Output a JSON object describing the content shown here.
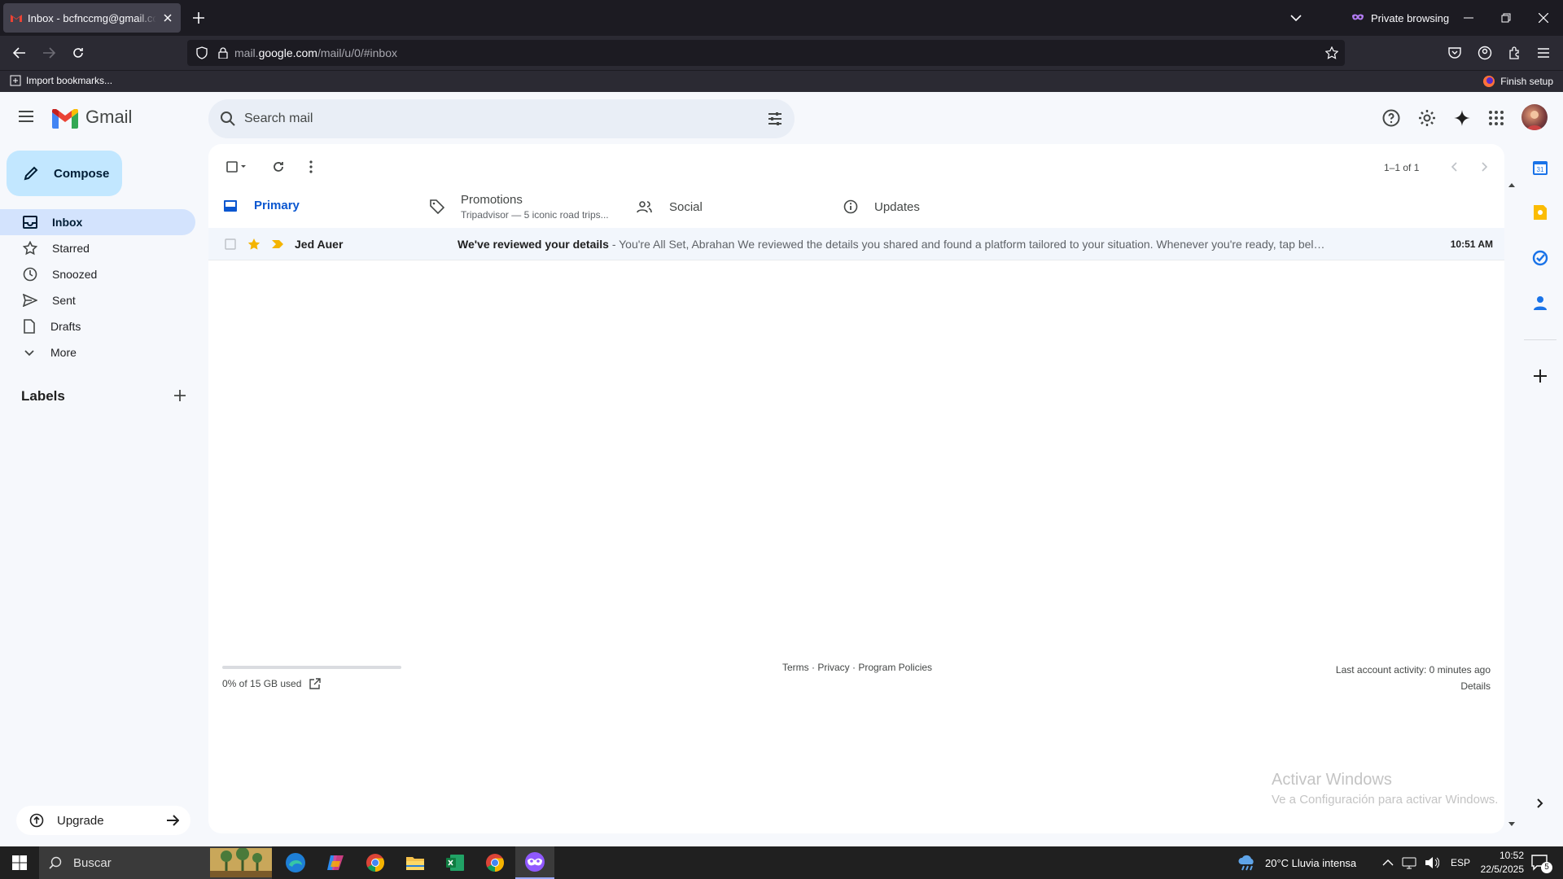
{
  "browser": {
    "tab_title": "Inbox - bcfnccmg@gmail.com - Gmail",
    "private_label": "Private browsing",
    "url_prefix": "mail.",
    "url_domain": "google.com",
    "url_path": "/mail/u/0/#inbox",
    "import_bookmarks": "Import bookmarks...",
    "finish_setup": "Finish setup"
  },
  "gmail": {
    "logo_text": "Gmail",
    "search_placeholder": "Search mail",
    "compose": "Compose",
    "nav": [
      {
        "label": "Inbox",
        "icon": "inbox-icon",
        "active": true
      },
      {
        "label": "Starred",
        "icon": "star-icon"
      },
      {
        "label": "Snoozed",
        "icon": "clock-icon"
      },
      {
        "label": "Sent",
        "icon": "send-icon"
      },
      {
        "label": "Drafts",
        "icon": "draft-icon"
      },
      {
        "label": "More",
        "icon": "chevron-down-icon"
      }
    ],
    "labels_title": "Labels",
    "upgrade": "Upgrade",
    "pager": "1–1 of 1",
    "tabs": [
      {
        "label": "Primary",
        "sub": ""
      },
      {
        "label": "Promotions",
        "sub": "Tripadvisor — 5 iconic road trips..."
      },
      {
        "label": "Social",
        "sub": ""
      },
      {
        "label": "Updates",
        "sub": ""
      }
    ],
    "emails": [
      {
        "sender": "Jed Auer",
        "subject": "We've reviewed your details",
        "snippet": " - You're All Set, Abrahan We reviewed the details you shared and found a platform tailored to your situation. Whenever you're ready, tap below to continue. ...",
        "time": "10:51 AM",
        "starred": true,
        "important": true
      }
    ],
    "storage": "0% of 15 GB used",
    "storage_fraction": 0,
    "footer_links": "Terms · Privacy · Program Policies",
    "last_activity": "Last account activity: 0 minutes ago",
    "details": "Details",
    "accent": "#0b57d0"
  },
  "watermark": {
    "line1": "Activar Windows",
    "line2": "Ve a Configuración para activar Windows."
  },
  "taskbar": {
    "search_placeholder": "Buscar",
    "weather": "20°C  Lluvia intensa",
    "lang": "ESP",
    "time": "10:52",
    "date": "22/5/2025",
    "notifications": "5"
  }
}
